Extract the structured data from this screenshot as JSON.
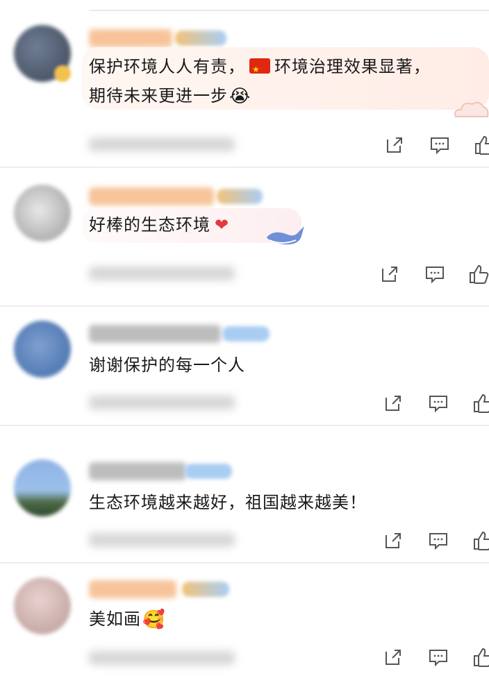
{
  "comments": [
    {
      "text": "保护环境人人有责，",
      "text2": "环境治理效果显著，",
      "text3": "期待未来更进一步",
      "emoji": "😭"
    },
    {
      "text": "好棒的生态环境",
      "emoji": "❤"
    },
    {
      "text": "谢谢保护的每一个人"
    },
    {
      "text": "生态环境越来越好，祖国越来越美！"
    },
    {
      "text": "美如画",
      "emoji": "🥰"
    }
  ],
  "icons": {
    "share": "share-icon",
    "comment": "comment-icon",
    "like": "thumbs-up-icon"
  },
  "colors": {
    "name_orange": "#f5a45a",
    "name_grey": "#b8b8b8",
    "badge_blue": "#8fc1f0",
    "separator": "#eeeeee"
  }
}
